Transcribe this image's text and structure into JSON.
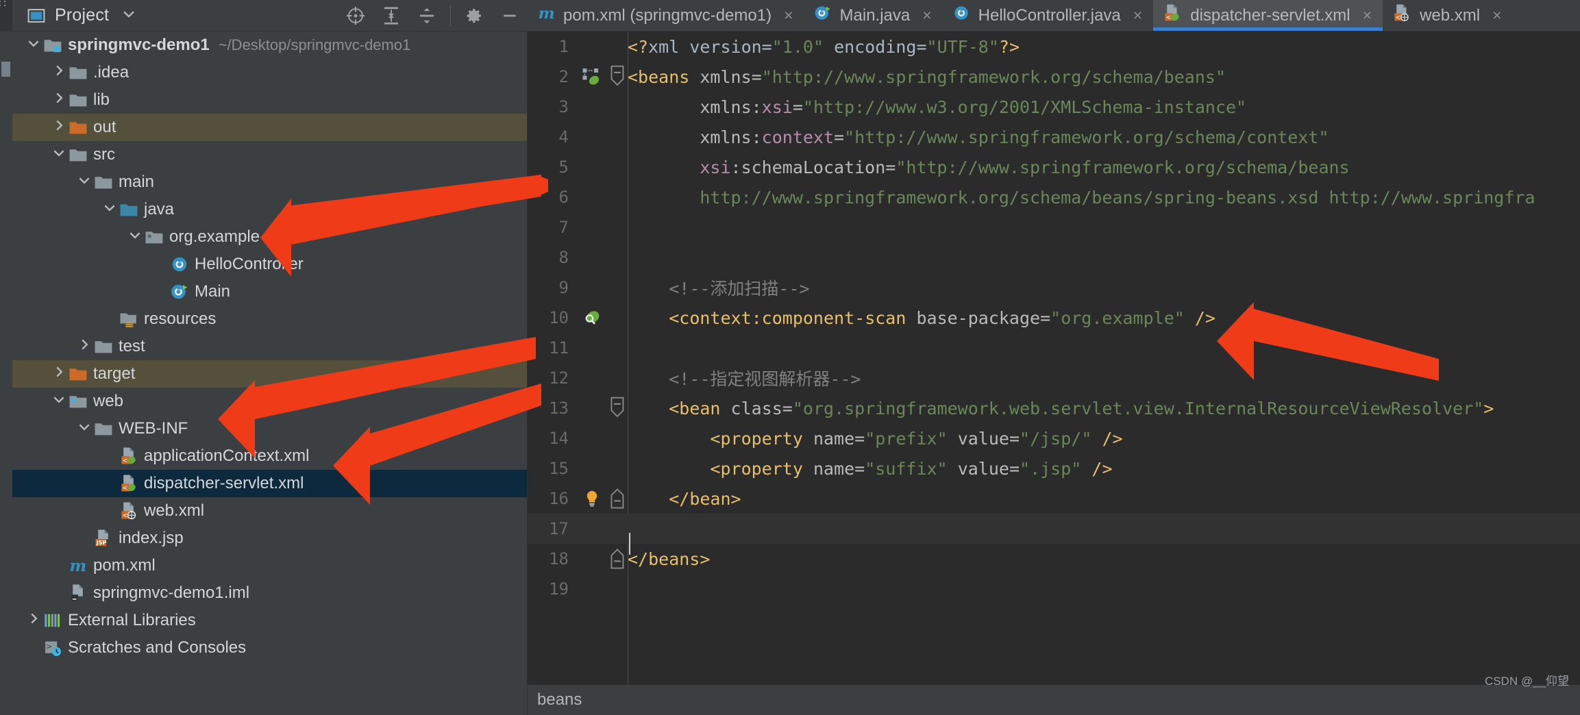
{
  "window": {
    "project_panel_title": "Project",
    "breadcrumb": "beans",
    "watermark": "CSDN @__仰望"
  },
  "toolbar": {
    "icons": [
      {
        "name": "locate-icon",
        "title": "Select Opened File"
      },
      {
        "name": "expand-all-icon",
        "title": "Expand All"
      },
      {
        "name": "collapse-all-icon",
        "title": "Collapse All"
      },
      {
        "name": "gear-icon",
        "title": "Settings"
      },
      {
        "name": "minimize-icon",
        "title": "Hide"
      }
    ]
  },
  "tabs": [
    {
      "label": "pom.xml (springmvc-demo1)",
      "icon": "maven-icon",
      "active": false,
      "close": "×"
    },
    {
      "label": "Main.java",
      "icon": "java-class-run-icon",
      "active": false,
      "close": "×"
    },
    {
      "label": "HelloController.java",
      "icon": "java-class-icon",
      "active": false,
      "close": "×"
    },
    {
      "label": "dispatcher-servlet.xml",
      "icon": "spring-xml-icon",
      "active": true,
      "close": "×"
    },
    {
      "label": "web.xml",
      "icon": "web-xml-icon",
      "active": false,
      "close": "×"
    }
  ],
  "tree": [
    {
      "indent": 0,
      "arrow": "v",
      "icon": "module-folder-icon",
      "label": "springmvc-demo1",
      "bold": true,
      "sub": "~/Desktop/springmvc-demo1",
      "state": "normal"
    },
    {
      "indent": 1,
      "arrow": ">",
      "icon": "folder-icon",
      "label": ".idea",
      "bold": false,
      "sub": "",
      "state": "normal"
    },
    {
      "indent": 1,
      "arrow": ">",
      "icon": "folder-icon",
      "label": "lib",
      "bold": false,
      "sub": "",
      "state": "normal"
    },
    {
      "indent": 1,
      "arrow": ">",
      "icon": "folder-excluded-icon",
      "label": "out",
      "bold": false,
      "sub": "",
      "state": "excluded"
    },
    {
      "indent": 1,
      "arrow": "v",
      "icon": "folder-icon",
      "label": "src",
      "bold": false,
      "sub": "",
      "state": "normal"
    },
    {
      "indent": 2,
      "arrow": "v",
      "icon": "folder-icon",
      "label": "main",
      "bold": false,
      "sub": "",
      "state": "normal"
    },
    {
      "indent": 3,
      "arrow": "v",
      "icon": "source-folder-icon",
      "label": "java",
      "bold": false,
      "sub": "",
      "state": "normal"
    },
    {
      "indent": 4,
      "arrow": "v",
      "icon": "package-icon",
      "label": "org.example",
      "bold": false,
      "sub": "",
      "state": "normal"
    },
    {
      "indent": 5,
      "arrow": "",
      "icon": "java-class-icon",
      "label": "HelloController",
      "bold": false,
      "sub": "",
      "state": "normal"
    },
    {
      "indent": 5,
      "arrow": "",
      "icon": "java-class-run-icon",
      "label": "Main",
      "bold": false,
      "sub": "",
      "state": "normal"
    },
    {
      "indent": 3,
      "arrow": "",
      "icon": "resources-folder-icon",
      "label": "resources",
      "bold": false,
      "sub": "",
      "state": "normal"
    },
    {
      "indent": 2,
      "arrow": ">",
      "icon": "folder-icon",
      "label": "test",
      "bold": false,
      "sub": "",
      "state": "normal"
    },
    {
      "indent": 1,
      "arrow": ">",
      "icon": "folder-excluded-icon",
      "label": "target",
      "bold": false,
      "sub": "",
      "state": "excluded"
    },
    {
      "indent": 1,
      "arrow": "v",
      "icon": "web-folder-icon",
      "label": "web",
      "bold": false,
      "sub": "",
      "state": "normal"
    },
    {
      "indent": 2,
      "arrow": "v",
      "icon": "folder-icon",
      "label": "WEB-INF",
      "bold": false,
      "sub": "",
      "state": "normal"
    },
    {
      "indent": 3,
      "arrow": "",
      "icon": "spring-xml-icon",
      "label": "applicationContext.xml",
      "bold": false,
      "sub": "",
      "state": "normal"
    },
    {
      "indent": 3,
      "arrow": "",
      "icon": "spring-xml-icon",
      "label": "dispatcher-servlet.xml",
      "bold": false,
      "sub": "",
      "state": "selected"
    },
    {
      "indent": 3,
      "arrow": "",
      "icon": "web-xml-icon",
      "label": "web.xml",
      "bold": false,
      "sub": "",
      "state": "normal"
    },
    {
      "indent": 2,
      "arrow": "",
      "icon": "jsp-icon",
      "label": "index.jsp",
      "bold": false,
      "sub": "",
      "state": "normal"
    },
    {
      "indent": 1,
      "arrow": "",
      "icon": "maven-icon",
      "label": "pom.xml",
      "bold": false,
      "sub": "",
      "state": "normal"
    },
    {
      "indent": 1,
      "arrow": "",
      "icon": "iml-icon",
      "label": "springmvc-demo1.iml",
      "bold": false,
      "sub": "",
      "state": "normal"
    },
    {
      "indent": 0,
      "arrow": ">",
      "icon": "libraries-icon",
      "label": "External Libraries",
      "bold": false,
      "sub": "",
      "state": "normal"
    },
    {
      "indent": 0,
      "arrow": "",
      "icon": "scratches-icon",
      "label": "Scratches and Consoles",
      "bold": false,
      "sub": "",
      "state": "normal"
    }
  ],
  "editor": {
    "filename": "dispatcher-servlet.xml",
    "cursor_line": 17,
    "lines": [
      {
        "n": 1,
        "gutter": "",
        "fold": "",
        "current": false,
        "tokens": [
          {
            "c": "t-pi",
            "t": "<?"
          },
          {
            "c": "t-plain",
            "t": "xml "
          },
          {
            "c": "t-plain",
            "t": "version="
          },
          {
            "c": "t-val",
            "t": "\"1.0\""
          },
          {
            "c": "t-plain",
            "t": " encoding="
          },
          {
            "c": "t-val",
            "t": "\"UTF-8\""
          },
          {
            "c": "t-pi",
            "t": "?>"
          }
        ]
      },
      {
        "n": 2,
        "gutter": "spring-bean-icon",
        "fold": "minus",
        "current": false,
        "tokens": [
          {
            "c": "t-tag",
            "t": "<beans"
          },
          {
            "c": "t-plain",
            "t": " "
          },
          {
            "c": "t-attr",
            "t": "xmlns="
          },
          {
            "c": "t-val",
            "t": "\"http://www.springframework.org/schema/beans\""
          }
        ]
      },
      {
        "n": 3,
        "gutter": "",
        "fold": "",
        "current": false,
        "tokens": [
          {
            "c": "t-plain",
            "t": "       "
          },
          {
            "c": "t-attr",
            "t": "xmlns:"
          },
          {
            "c": "t-ns",
            "t": "xsi"
          },
          {
            "c": "t-attr",
            "t": "="
          },
          {
            "c": "t-val",
            "t": "\"http://www.w3.org/2001/XMLSchema-instance\""
          }
        ]
      },
      {
        "n": 4,
        "gutter": "",
        "fold": "",
        "current": false,
        "tokens": [
          {
            "c": "t-plain",
            "t": "       "
          },
          {
            "c": "t-attr",
            "t": "xmlns:"
          },
          {
            "c": "t-ns",
            "t": "context"
          },
          {
            "c": "t-attr",
            "t": "="
          },
          {
            "c": "t-val",
            "t": "\"http://www.springframework.org/schema/context\""
          }
        ]
      },
      {
        "n": 5,
        "gutter": "",
        "fold": "",
        "current": false,
        "tokens": [
          {
            "c": "t-plain",
            "t": "       "
          },
          {
            "c": "t-ns",
            "t": "xsi"
          },
          {
            "c": "t-attr",
            "t": ":schemaLocation="
          },
          {
            "c": "t-val",
            "t": "\"http://www.springframework.org/schema/beans"
          }
        ]
      },
      {
        "n": 6,
        "gutter": "",
        "fold": "",
        "current": false,
        "tokens": [
          {
            "c": "t-plain",
            "t": "       "
          },
          {
            "c": "t-val",
            "t": "http://www.springframework.org/schema/beans/spring-beans.xsd http://www.springfra"
          }
        ]
      },
      {
        "n": 7,
        "gutter": "",
        "fold": "",
        "current": false,
        "tokens": []
      },
      {
        "n": 8,
        "gutter": "",
        "fold": "",
        "current": false,
        "tokens": []
      },
      {
        "n": 9,
        "gutter": "",
        "fold": "",
        "current": false,
        "tokens": [
          {
            "c": "t-plain",
            "t": "    "
          },
          {
            "c": "t-cmt",
            "t": "<!--添加扫描-->"
          }
        ]
      },
      {
        "n": 10,
        "gutter": "spring-scan-icon",
        "fold": "",
        "current": false,
        "tokens": [
          {
            "c": "t-plain",
            "t": "    "
          },
          {
            "c": "t-tag",
            "t": "<context:component-scan"
          },
          {
            "c": "t-plain",
            "t": " "
          },
          {
            "c": "t-attr",
            "t": "base-package="
          },
          {
            "c": "t-val",
            "t": "\"org.example\""
          },
          {
            "c": "t-plain",
            "t": " "
          },
          {
            "c": "t-tag",
            "t": "/>"
          }
        ]
      },
      {
        "n": 11,
        "gutter": "",
        "fold": "",
        "current": false,
        "tokens": []
      },
      {
        "n": 12,
        "gutter": "",
        "fold": "",
        "current": false,
        "tokens": [
          {
            "c": "t-plain",
            "t": "    "
          },
          {
            "c": "t-cmt",
            "t": "<!--指定视图解析器-->"
          }
        ]
      },
      {
        "n": 13,
        "gutter": "",
        "fold": "minus",
        "current": false,
        "tokens": [
          {
            "c": "t-plain",
            "t": "    "
          },
          {
            "c": "t-tag",
            "t": "<bean"
          },
          {
            "c": "t-plain",
            "t": " "
          },
          {
            "c": "t-attr",
            "t": "class="
          },
          {
            "c": "t-val",
            "t": "\"org.springframework.web.servlet.view.InternalResourceViewResolver\""
          },
          {
            "c": "t-tag",
            "t": ">"
          }
        ]
      },
      {
        "n": 14,
        "gutter": "",
        "fold": "",
        "current": false,
        "tokens": [
          {
            "c": "t-plain",
            "t": "        "
          },
          {
            "c": "t-tag",
            "t": "<property"
          },
          {
            "c": "t-plain",
            "t": " "
          },
          {
            "c": "t-attr",
            "t": "name="
          },
          {
            "c": "t-val",
            "t": "\"prefix\""
          },
          {
            "c": "t-plain",
            "t": " "
          },
          {
            "c": "t-attr",
            "t": "value="
          },
          {
            "c": "t-val",
            "t": "\"/jsp/\""
          },
          {
            "c": "t-plain",
            "t": " "
          },
          {
            "c": "t-tag",
            "t": "/>"
          }
        ]
      },
      {
        "n": 15,
        "gutter": "",
        "fold": "",
        "current": false,
        "tokens": [
          {
            "c": "t-plain",
            "t": "        "
          },
          {
            "c": "t-tag",
            "t": "<property"
          },
          {
            "c": "t-plain",
            "t": " "
          },
          {
            "c": "t-attr",
            "t": "name="
          },
          {
            "c": "t-val",
            "t": "\"suffix\""
          },
          {
            "c": "t-plain",
            "t": " "
          },
          {
            "c": "t-attr",
            "t": "value="
          },
          {
            "c": "t-val",
            "t": "\".jsp\""
          },
          {
            "c": "t-plain",
            "t": " "
          },
          {
            "c": "t-tag",
            "t": "/>"
          }
        ]
      },
      {
        "n": 16,
        "gutter": "lightbulb-icon",
        "fold": "minus-end",
        "current": false,
        "tokens": [
          {
            "c": "t-plain",
            "t": "    "
          },
          {
            "c": "t-tag",
            "t": "</bean>"
          }
        ]
      },
      {
        "n": 17,
        "gutter": "",
        "fold": "",
        "current": true,
        "tokens": []
      },
      {
        "n": 18,
        "gutter": "",
        "fold": "minus-end",
        "current": false,
        "tokens": [
          {
            "c": "t-tag",
            "t": "</beans>"
          }
        ]
      },
      {
        "n": 19,
        "gutter": "",
        "fold": "",
        "current": false,
        "tokens": []
      }
    ]
  },
  "annotations": {
    "arrows": [
      {
        "name": "arrow-to-org-example"
      },
      {
        "name": "arrow-to-web-inf"
      },
      {
        "name": "arrow-to-dispatcher-servlet"
      },
      {
        "name": "arrow-to-component-scan"
      }
    ],
    "color": "#f03b18"
  }
}
